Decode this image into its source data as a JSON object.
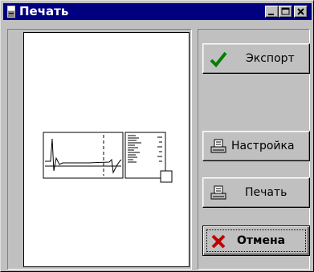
{
  "window": {
    "title": "Печать",
    "controls": [
      "minimize",
      "maximize",
      "close"
    ]
  },
  "preview": {
    "description_icon": "page-preview"
  },
  "buttons": {
    "export": {
      "label": "Экспорт",
      "icon": "checkmark-icon",
      "icon_color": "#008000"
    },
    "setup": {
      "label": "Настройка",
      "icon": "printer-icon"
    },
    "print": {
      "label": "Печать",
      "icon": "printer-icon"
    },
    "cancel": {
      "label": "Отмена",
      "icon": "x-icon",
      "icon_color": "#c00000"
    }
  },
  "colors": {
    "titlebar": "#000080",
    "face": "#c0c0c0"
  }
}
